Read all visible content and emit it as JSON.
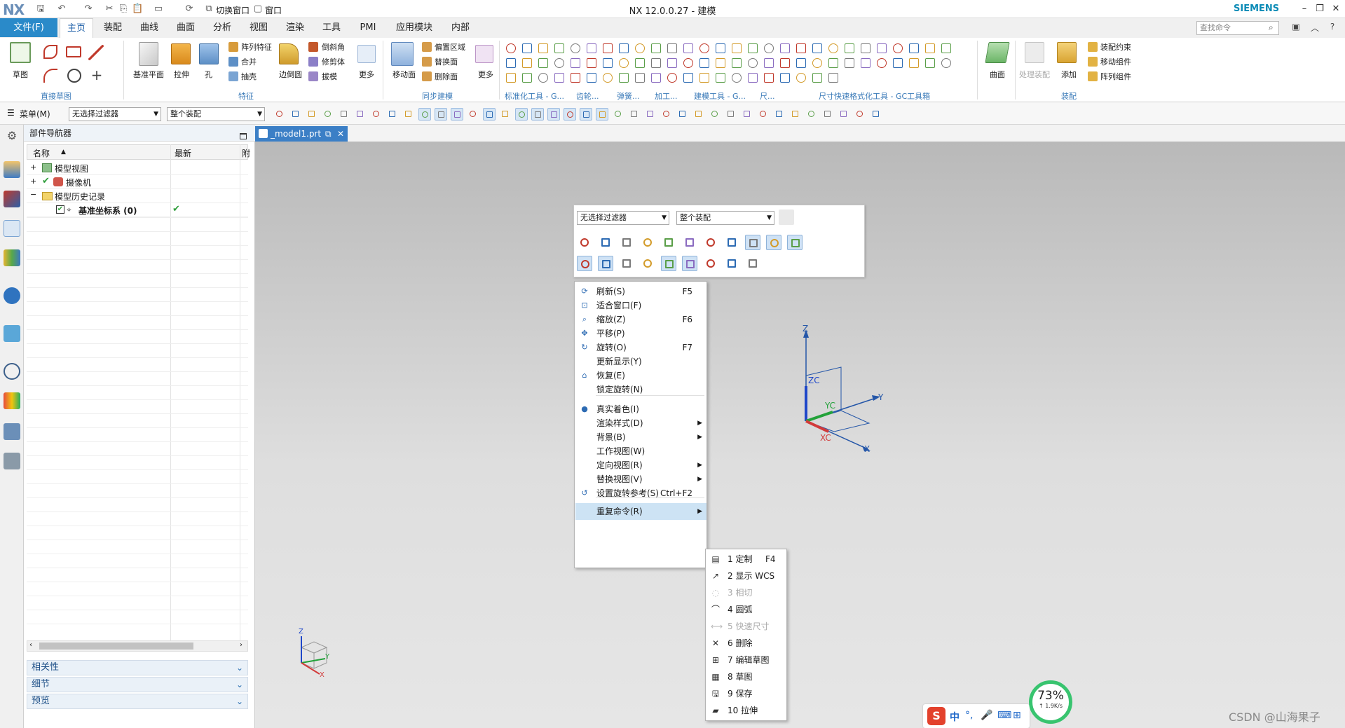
{
  "title_bar": {
    "logo": "NX",
    "window_title": "NX 12.0.0.27 - 建模",
    "brand": "SIEMENS",
    "switch_window": "切换窗口",
    "window_menu": "窗口"
  },
  "menu_tabs": [
    "文件(F)",
    "主页",
    "装配",
    "曲线",
    "曲面",
    "分析",
    "视图",
    "渲染",
    "工具",
    "PMI",
    "应用模块",
    "内部"
  ],
  "search_placeholder": "查找命令",
  "ribbon": {
    "buttons": {
      "sketch": "草图",
      "datum_plane": "基准平面",
      "extrude": "拉伸",
      "hole": "孔",
      "pattern_feature": "阵列特征",
      "unite": "合并",
      "shell": "抽壳",
      "edge_blend": "边倒圆",
      "chamfer": "倒斜角",
      "trim_body": "修剪体",
      "draft": "拔模",
      "more1": "更多",
      "move_face": "移动面",
      "offset_region": "偏置区域",
      "replace_face": "替换面",
      "delete_face": "删除面",
      "more2": "更多",
      "surface": "曲面",
      "process_assembly": "处理装配",
      "add": "添加",
      "assembly_constraint": "装配约束",
      "move_component": "移动组件",
      "pattern_component": "阵列组件"
    },
    "groups": [
      "直接草图",
      "特征",
      "同步建模",
      "标准化工具 - G...",
      "齿轮...",
      "弹簧...",
      "加工...",
      "建模工具 - G...",
      "尺...",
      "尺寸快速格式化工具 - GC工具箱",
      "装配"
    ]
  },
  "toolbar2": {
    "menu": "菜单(M)",
    "filter": "无选择过滤器",
    "scope": "整个装配"
  },
  "navigator": {
    "title": "部件导航器",
    "col_name": "名称",
    "col_latest": "最新",
    "col_extra": "附",
    "rows": [
      {
        "label": "模型视图",
        "latest": ""
      },
      {
        "label": "摄像机",
        "latest": ""
      },
      {
        "label": "模型历史记录",
        "latest": ""
      },
      {
        "label": "基准坐标系 (0)",
        "latest": "✔"
      }
    ],
    "panels": [
      "相关性",
      "细节",
      "预览"
    ]
  },
  "doc_tab": "_model1.prt",
  "float_bar": {
    "filter": "无选择过滤器",
    "scope": "整个装配"
  },
  "context_menu": [
    {
      "label": "刷新(S)",
      "shortcut": "F5",
      "icon": "refresh-icon"
    },
    {
      "label": "适合窗口(F)",
      "shortcut": "",
      "icon": "fit-icon"
    },
    {
      "label": "缩放(Z)",
      "shortcut": "F6",
      "icon": "zoom-icon"
    },
    {
      "label": "平移(P)",
      "shortcut": "",
      "icon": "pan-icon"
    },
    {
      "label": "旋转(O)",
      "shortcut": "F7",
      "icon": "rotate-icon"
    },
    {
      "label": "更新显示(Y)",
      "shortcut": "",
      "icon": ""
    },
    {
      "label": "恢复(E)",
      "shortcut": "",
      "icon": "restore-icon"
    },
    {
      "label": "锁定旋转(N)",
      "shortcut": "",
      "icon": ""
    },
    {
      "label": "真实着色(I)",
      "shortcut": "",
      "icon": "shading-icon"
    },
    {
      "label": "渲染样式(D)",
      "shortcut": "",
      "icon": ""
    },
    {
      "label": "背景(B)",
      "shortcut": "",
      "icon": ""
    },
    {
      "label": "工作视图(W)",
      "shortcut": "",
      "icon": ""
    },
    {
      "label": "定向视图(R)",
      "shortcut": "",
      "icon": ""
    },
    {
      "label": "替换视图(V)",
      "shortcut": "",
      "icon": ""
    },
    {
      "label": "设置旋转参考(S)",
      "shortcut": "Ctrl+F2",
      "icon": "rotate-ref-icon"
    },
    {
      "label": "重复命令(R)",
      "shortcut": "",
      "icon": ""
    }
  ],
  "submenu": [
    {
      "label": "1 定制",
      "shortcut": "F4",
      "disabled": false
    },
    {
      "label": "2 显示 WCS",
      "shortcut": "",
      "disabled": false
    },
    {
      "label": "3 相切",
      "shortcut": "",
      "disabled": true
    },
    {
      "label": "4 圆弧",
      "shortcut": "",
      "disabled": false
    },
    {
      "label": "5 快速尺寸",
      "shortcut": "",
      "disabled": true
    },
    {
      "label": "6 删除",
      "shortcut": "",
      "disabled": false
    },
    {
      "label": "7 编辑草图",
      "shortcut": "",
      "disabled": false
    },
    {
      "label": "8 草图",
      "shortcut": "",
      "disabled": false
    },
    {
      "label": "9 保存",
      "shortcut": "",
      "disabled": false
    },
    {
      "label": "10 拉伸",
      "shortcut": "",
      "disabled": false
    }
  ],
  "axes": {
    "z": "Z",
    "y": "Y",
    "x": "X",
    "zc": "ZC",
    "yc": "YC",
    "xc": "XC"
  },
  "mini_triad": {
    "z": "Z",
    "y": "Y",
    "x": "X"
  },
  "status": {
    "ime": "中",
    "speed_percent": "73%",
    "speed_rate": "↑ 1.9K/s",
    "watermark": "CSDN @山海果子"
  }
}
